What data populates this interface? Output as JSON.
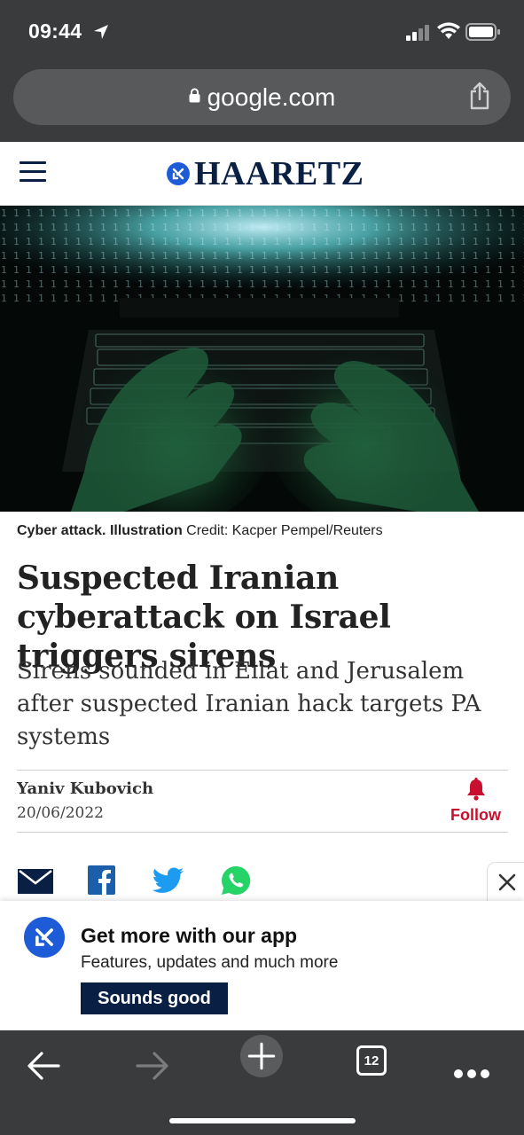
{
  "status_bar": {
    "time": "09:44"
  },
  "browser": {
    "url": "google.com",
    "tab_count": "12"
  },
  "site": {
    "logo_text": "HAARETZ"
  },
  "article": {
    "caption_bold": "Cyber attack. Illustration",
    "caption_credit": "Credit: Kacper Pempel/Reuters",
    "headline": "Suspected Iranian cyberattack on Israel triggers sirens",
    "subheadline": "Sirens sounded in Eilat and Jerusalem after suspected Iranian hack targets PA systems",
    "author": "Yaniv Kubovich",
    "date": "20/06/2022",
    "follow_label": "Follow"
  },
  "share": {
    "icons": [
      "mail-icon",
      "facebook-icon",
      "twitter-icon",
      "whatsapp-icon"
    ]
  },
  "promo": {
    "title": "Get more with our app",
    "subtitle": "Features, updates and much more",
    "button_label": "Sounds good"
  },
  "colors": {
    "brand_navy": "#0a1f44",
    "brand_blue": "#1e5bd6",
    "follow_red": "#c8102e",
    "chrome_dark": "#3a3b3d"
  }
}
